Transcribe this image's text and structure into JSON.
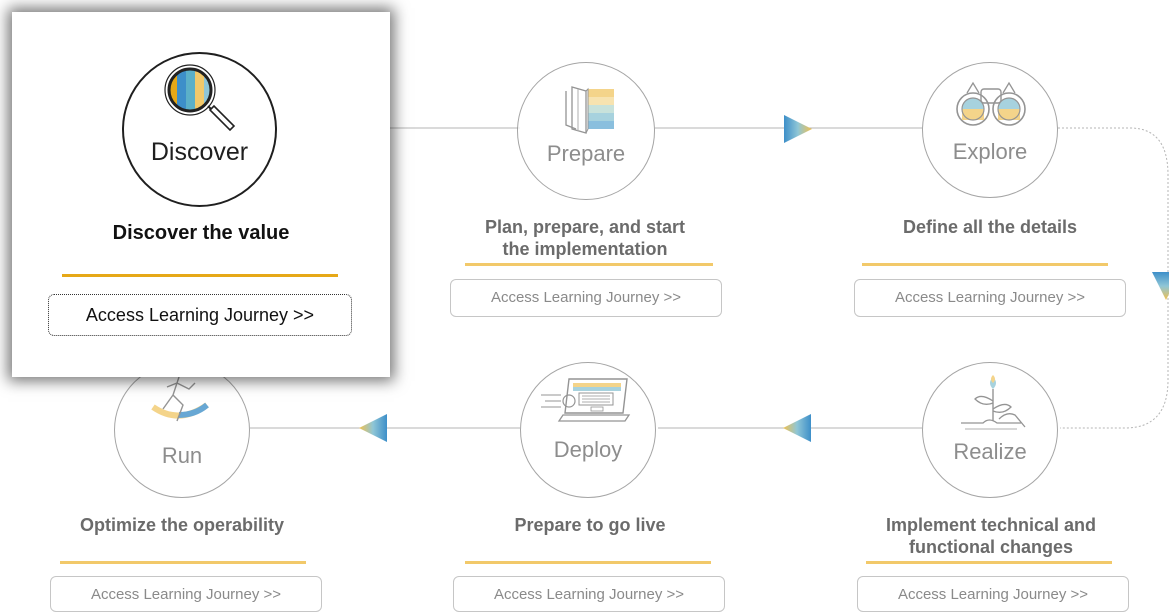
{
  "phases": {
    "discover": {
      "circle_label": "Discover",
      "description": "Discover the value",
      "button_label": "Access Learning Journey >>",
      "icon": "magnifier-icon"
    },
    "prepare": {
      "circle_label": "Prepare",
      "description_line1": "Plan, prepare, and start",
      "description_line2": "the implementation",
      "button_label": "Access Learning Journey >>",
      "icon": "book-icon"
    },
    "explore": {
      "circle_label": "Explore",
      "description": "Define all the details",
      "button_label": "Access Learning Journey >>",
      "icon": "binoculars-icon"
    },
    "realize": {
      "circle_label": "Realize",
      "description_line1": "Implement technical and",
      "description_line2": "functional changes",
      "button_label": "Access Learning Journey >>",
      "icon": "plant-hand-icon"
    },
    "deploy": {
      "circle_label": "Deploy",
      "description": "Prepare to go live",
      "button_label": "Access Learning Journey >>",
      "icon": "laptop-icon"
    },
    "run": {
      "circle_label": "Run",
      "description": "Optimize the operability",
      "button_label": "Access Learning Journey >>",
      "icon": "runner-icon"
    }
  },
  "colors": {
    "accent_yellow": "#f2c96a",
    "accent_blue": "#3d8fc9",
    "highlight_underline": "#e6a817"
  }
}
